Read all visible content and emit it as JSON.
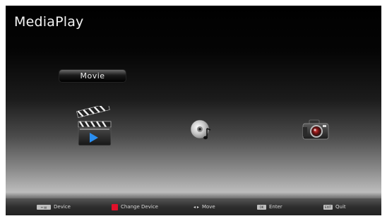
{
  "app": {
    "title": "MediaPlay"
  },
  "selection": {
    "label": "Movie"
  },
  "media_items": [
    {
      "icon": "movie-clapper-icon"
    },
    {
      "icon": "music-disc-icon"
    },
    {
      "icon": "photo-camera-icon"
    }
  ],
  "footer": {
    "device_key": "↔ ▤",
    "device": "Device",
    "change_device": "Change Device",
    "move_key": "◂ ▸",
    "move": "Move",
    "enter_key": "OK",
    "enter": "Enter",
    "quit_key": "EXIT",
    "quit": "Quit"
  },
  "colors": {
    "red_key": "#e0102a",
    "accent_blue": "#1e73d8"
  }
}
